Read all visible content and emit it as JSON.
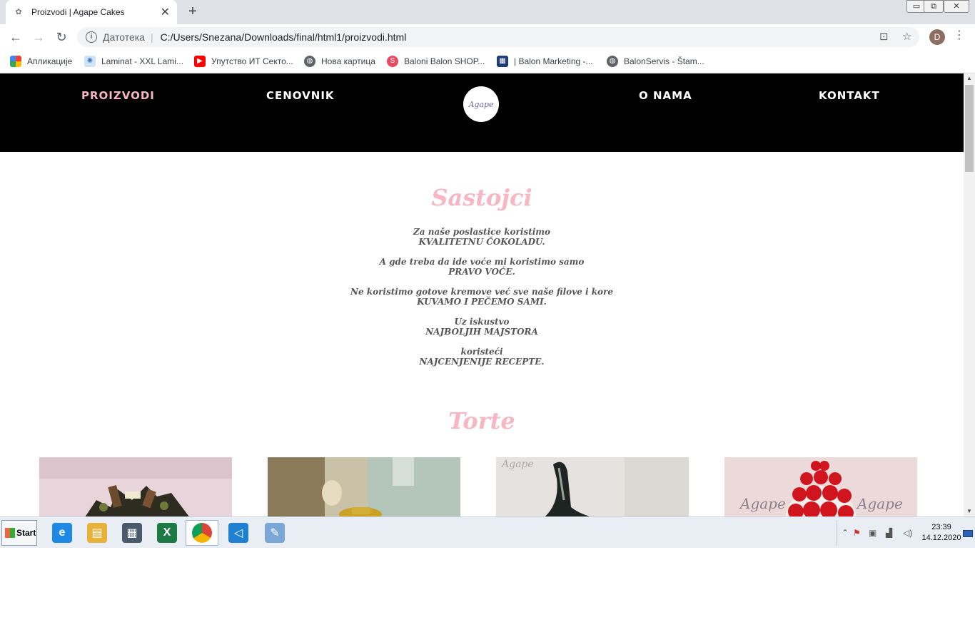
{
  "browser": {
    "tab_title": "Proizvodi | Agape Cakes",
    "new_tab_glyph": "+",
    "close_glyph": "✕",
    "window_controls": [
      "▭",
      "⧉",
      "✕"
    ],
    "omnibox": {
      "scheme_label": "Датотека",
      "url": "C:/Users/Snezana/Downloads/final/html1/proizvodi.html"
    },
    "profile_initial": "D",
    "bookmarks": [
      {
        "label": "Апликације",
        "icon": "apps-grid-icon"
      },
      {
        "label": "Laminat - XXL Lami...",
        "icon": "laminat-icon"
      },
      {
        "label": "Упутство ИТ Секто...",
        "icon": "youtube-icon"
      },
      {
        "label": "Нова картица",
        "icon": "globe-icon"
      },
      {
        "label": "Baloni Balon SHOP...",
        "icon": "baloni-s-icon"
      },
      {
        "label": "| Balon Marketing -...",
        "icon": "balon-marketing-icon"
      },
      {
        "label": "BalonServis - Štam...",
        "icon": "globe-icon"
      }
    ]
  },
  "site": {
    "nav": {
      "proizvodi": "PROIZVODI",
      "cenovnik": "CENOVNIK",
      "logo_text": "Agape",
      "o_nama": "O NAMA",
      "kontakt": "KONTAKT"
    },
    "sastojci_title": "Sastojci",
    "ingredients": [
      {
        "line1": "Za naše poslastice koristimo",
        "line2": "KVALITETNU ČOKOLADU."
      },
      {
        "line1": "A gde treba da ide voće mi koristimo samo",
        "line2": "PRAVO VOĆE."
      },
      {
        "line1": "Ne koristimo gotove kremove već sve naše filove i kore",
        "line2": "KUVAMO I PEČEMO SAMI."
      },
      {
        "line1": "Uz iskustvo",
        "line2": "NAJBOLJIH MAJSTORA"
      },
      {
        "line1": "koristeći",
        "line2": "NAJCENJENIJE RECEPTE."
      }
    ],
    "torte_title": "Torte",
    "cake_watermark": "Agape"
  },
  "taskbar": {
    "start_label": "Start",
    "apps": [
      {
        "name": "internet-explorer-icon",
        "glyph": "e",
        "color": "#1e88e5"
      },
      {
        "name": "file-explorer-icon",
        "glyph": "▤",
        "color": "#e6b23a"
      },
      {
        "name": "calculator-icon",
        "glyph": "▦",
        "color": "#4a5a6a"
      },
      {
        "name": "excel-icon",
        "glyph": "X",
        "color": "#1d7a45"
      },
      {
        "name": "chrome-icon",
        "glyph": "◉",
        "color": "#db4437"
      },
      {
        "name": "vscode-icon",
        "glyph": "◁",
        "color": "#1f7fd1"
      },
      {
        "name": "paint-icon",
        "glyph": "✎",
        "color": "#7aa6d8"
      }
    ],
    "clock_time": "23:39",
    "clock_date": "14.12.2020"
  }
}
